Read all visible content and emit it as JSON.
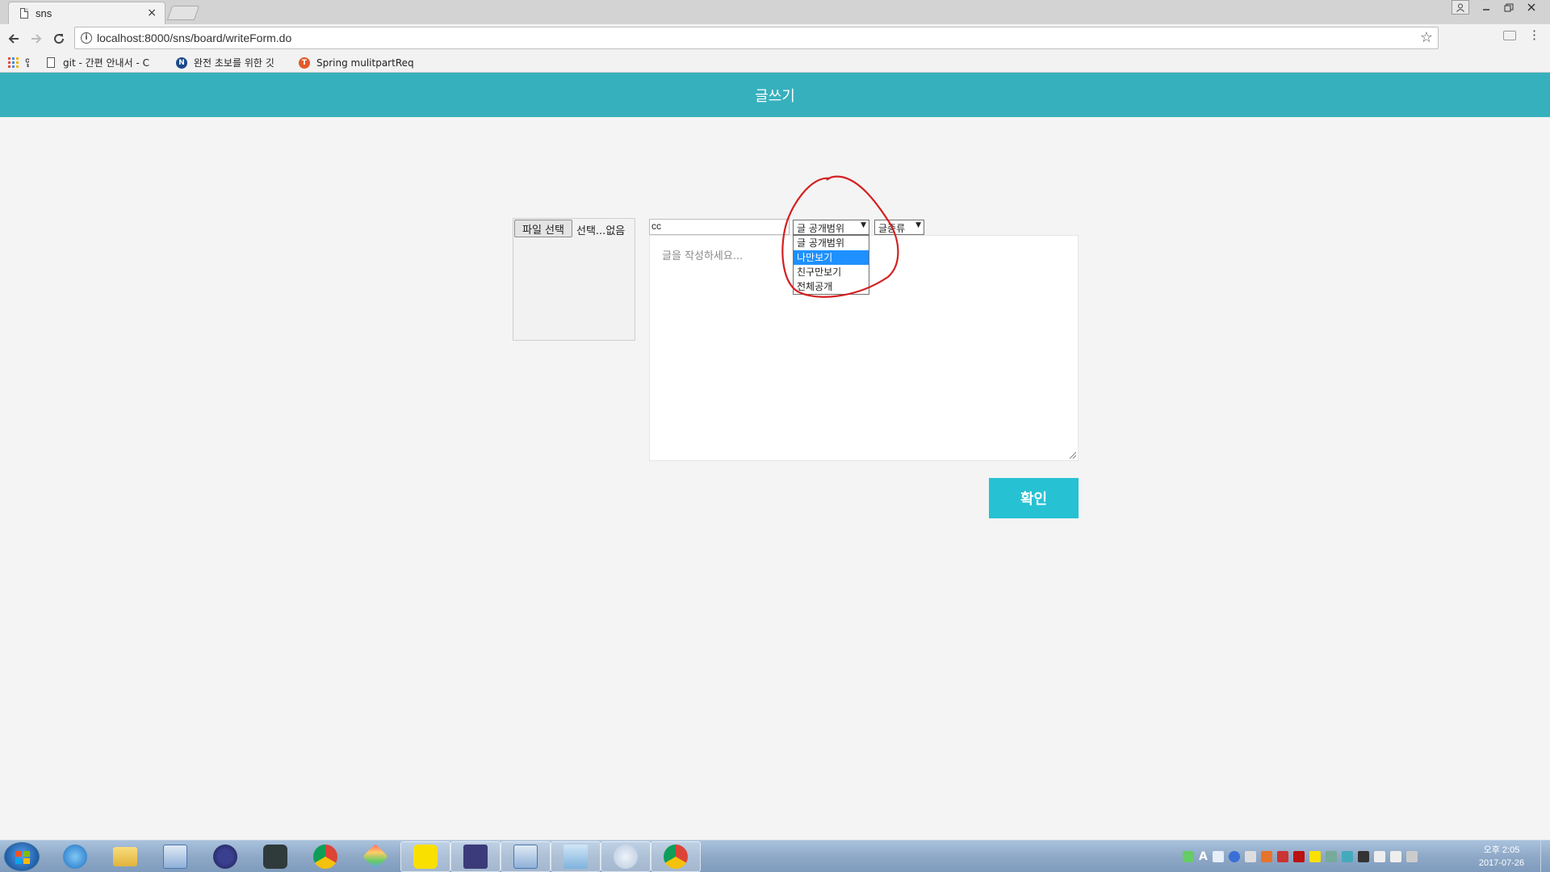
{
  "browser": {
    "tab_title": "sns",
    "tab_close": "×",
    "url": "localhost:8000/sns/board/writeForm.do",
    "bookmarks": [
      {
        "label": "앱",
        "icon": "apps-icon"
      },
      {
        "label": "git - 간편 안내서 - C",
        "icon": "document-icon"
      },
      {
        "label": "완전 초보를 위한 깃",
        "icon": "n-logo-icon"
      },
      {
        "label": "Spring mulitpartReq",
        "icon": "t-logo-icon"
      }
    ]
  },
  "page": {
    "header_title": "글쓰기",
    "file_button_label": "파일 선택",
    "file_status": "선택...없음",
    "title_input_value": "cc",
    "scope_select": {
      "selected": "글 공개범위",
      "options": [
        "글 공개범위",
        "나만보기",
        "친구만보기",
        "전체공개"
      ],
      "highlighted": "나만보기"
    },
    "kind_select_value": "글종류",
    "textarea_placeholder": "글을 작성하세요...",
    "confirm_label": "확인"
  },
  "taskbar": {
    "clock_time": "오후 2:05",
    "clock_date": "2017-07-26",
    "apps": [
      "internet-explorer-icon",
      "file-explorer-icon",
      "media-player-icon",
      "eclipse-icon",
      "nox-icon",
      "chrome-icon",
      "app-icon",
      "kakaotalk-icon",
      "java-ee-icon",
      "media-player-icon",
      "notepad-icon",
      "paint-icon",
      "chrome-icon"
    ]
  },
  "colors": {
    "header": "#37b0bd",
    "confirm": "#26c1d3",
    "highlight": "#1e90ff",
    "annotation": "#d42020"
  }
}
